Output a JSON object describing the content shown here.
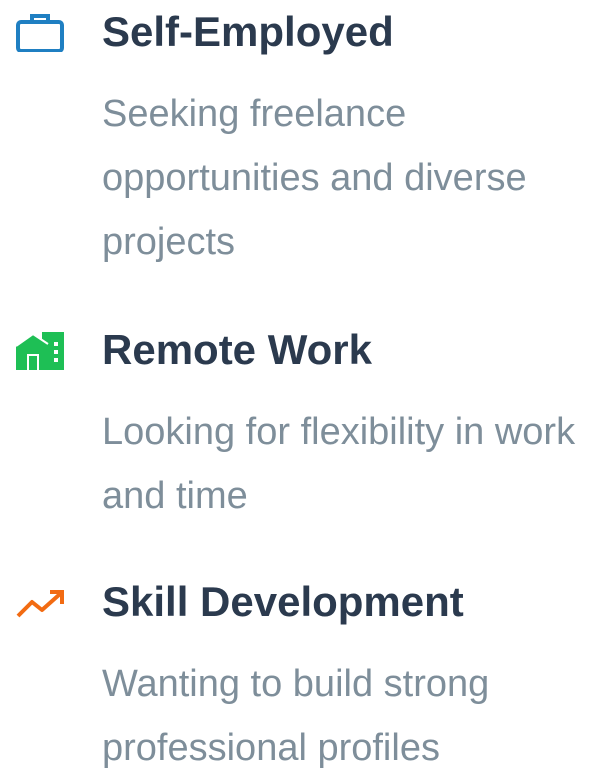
{
  "colors": {
    "title": "#2b3a4e",
    "description": "#7e8e9a",
    "briefcase_icon": "#1f7fc2",
    "home_icon": "#1ebf55",
    "trend_icon": "#f26b12"
  },
  "items": [
    {
      "icon": "briefcase-icon",
      "title": "Self-Employed",
      "description": "Seeking freelance opportunities and diverse projects"
    },
    {
      "icon": "home-office-icon",
      "title": "Remote Work",
      "description": "Looking for flexibility in work and time"
    },
    {
      "icon": "trending-up-icon",
      "title": "Skill Development",
      "description": "Wanting to build strong professional profiles"
    }
  ]
}
